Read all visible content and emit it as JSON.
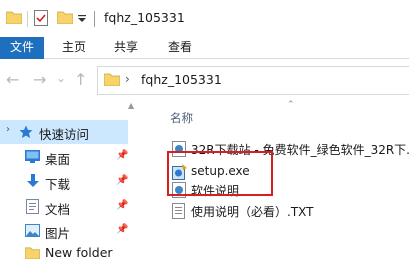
{
  "window": {
    "title": "fqhz_105331"
  },
  "ribbon": {
    "tabs": [
      "文件",
      "主页",
      "共享",
      "查看"
    ]
  },
  "address": {
    "path_item": "fqhz_105331",
    "chevron": "›"
  },
  "nav_buttons": {
    "back": "←",
    "forward": "→",
    "recent": "⌄",
    "up": "↑"
  },
  "sidebar": {
    "items": [
      {
        "label": "快速访问",
        "icon": "star-icon",
        "pinned": false,
        "selected": true
      },
      {
        "label": "桌面",
        "icon": "desktop-folder-icon",
        "pinned": true
      },
      {
        "label": "下载",
        "icon": "download-folder-icon",
        "pinned": true
      },
      {
        "label": "文档",
        "icon": "documents-folder-icon",
        "pinned": true
      },
      {
        "label": "图片",
        "icon": "pictures-folder-icon",
        "pinned": true
      },
      {
        "label": "New folder",
        "icon": "folder-icon",
        "pinned": false
      }
    ]
  },
  "file_list": {
    "column_header": "名称",
    "files": [
      {
        "name": "32R下载站 - 免费软件_绿色软件_32R下...",
        "icon": "internet-shortcut-icon"
      },
      {
        "name": "setup.exe",
        "icon": "installer-icon"
      },
      {
        "name": "软件说明",
        "icon": "internet-shortcut-icon"
      },
      {
        "name": "使用说明（必看）.TXT",
        "icon": "text-file-icon"
      }
    ]
  },
  "colors": {
    "accent": "#1f6fbf",
    "selection": "#cce8ff",
    "highlight": "#d42020",
    "folder": "#f7d46a"
  }
}
